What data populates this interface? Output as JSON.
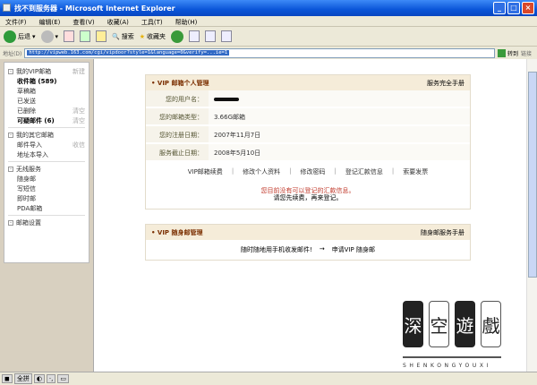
{
  "window": {
    "title": "找不到服务器 - Microsoft Internet Explorer"
  },
  "menu": [
    "文件(F)",
    "编辑(E)",
    "查看(V)",
    "收藏(A)",
    "工具(T)",
    "帮助(H)"
  ],
  "toolbar": {
    "back": "后退",
    "search": "搜索",
    "favorites": "收藏夹"
  },
  "address": {
    "label": "地址(D)",
    "url": "http://vipweb.163.com/cgi/vipdoor?style=1&language=0&verify=...ie=1",
    "go": "转到",
    "links": "链接"
  },
  "sidebar": {
    "sections": [
      {
        "title": "我的VIP邮箱",
        "action": "新建",
        "items": [
          {
            "label": "收件箱 (589)",
            "bold": true,
            "action": ""
          },
          {
            "label": "草稿箱",
            "action": ""
          },
          {
            "label": "已发送",
            "action": ""
          },
          {
            "label": "已删除",
            "action": "清空"
          },
          {
            "label": "可疑邮件 (6)",
            "bold": true,
            "action": "清空"
          }
        ]
      },
      {
        "title": "我的其它邮箱",
        "action": "",
        "items": [
          {
            "label": "邮件导入",
            "action": "收信"
          },
          {
            "label": "地址本导入",
            "action": ""
          }
        ]
      },
      {
        "title": "无线服务",
        "action": "",
        "items": [
          {
            "label": "随身邮",
            "action": ""
          },
          {
            "label": "写短信",
            "action": ""
          },
          {
            "label": "即时邮",
            "action": ""
          },
          {
            "label": "PDA邮箱",
            "action": ""
          }
        ]
      },
      {
        "title": "邮箱设置",
        "action": "",
        "items": []
      }
    ]
  },
  "card1": {
    "title": "• VIP 邮箱个人管理",
    "manual": "服务完全手册",
    "rows": [
      {
        "label": "您的用户名：",
        "value": ""
      },
      {
        "label": "您的邮箱类型：",
        "value": "3.66G邮箱"
      },
      {
        "label": "您的注册日期：",
        "value": "2007年11月7日"
      },
      {
        "label": "服务截止日期：",
        "value": "2008年5月10日"
      }
    ],
    "links": [
      "VIP邮箱续费",
      "修改个人资料",
      "修改密码",
      "登记汇款信息",
      "索要发票"
    ],
    "notice_red": "您目前没有可以登记的汇款信息。",
    "notice": "请您先续费，再来登记。"
  },
  "card2": {
    "title": "• VIP 随身邮管理",
    "manual": "随身邮服务手册",
    "text": "随时随地用手机收发邮件!",
    "arrow": "→",
    "link": "申请VIP 随身邮"
  },
  "watermark": {
    "chars": [
      "深",
      "空",
      "遊",
      "戲"
    ],
    "sub": "SHENKONGYOUXI"
  },
  "status": {
    "ime": "全拼"
  }
}
